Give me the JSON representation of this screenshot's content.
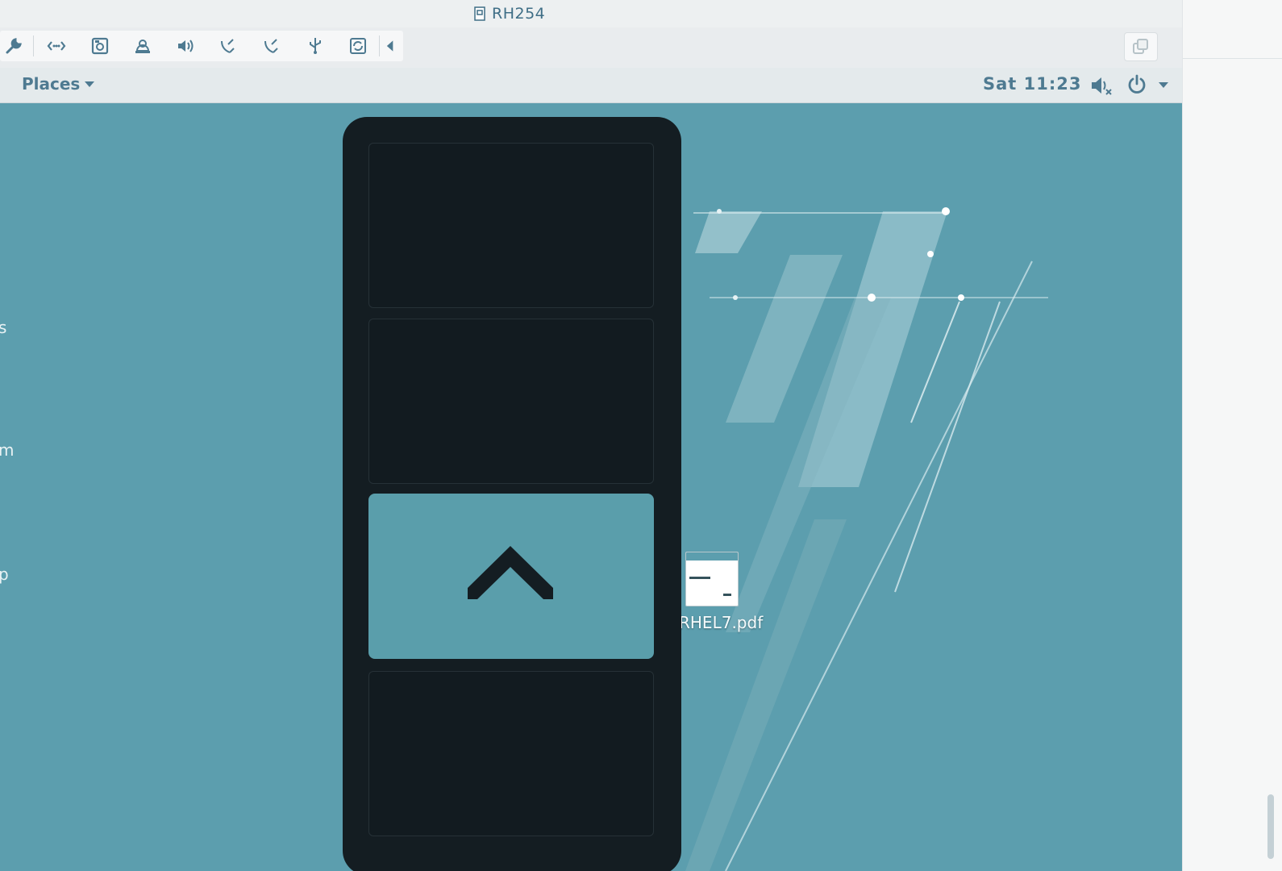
{
  "window": {
    "title": "RH254"
  },
  "toolbar": {
    "buttons": [
      {
        "name": "settings-wrench-icon"
      },
      {
        "name": "network-icon"
      },
      {
        "name": "disk-icon"
      },
      {
        "name": "shared-folder-icon"
      },
      {
        "name": "audio-icon"
      },
      {
        "name": "serial-port-icon"
      },
      {
        "name": "serial-port-icon-2"
      },
      {
        "name": "usb-icon"
      },
      {
        "name": "refresh-icon"
      },
      {
        "name": "collapse-left-icon"
      }
    ]
  },
  "panel": {
    "places_label": "Places",
    "clock": "Sat 11:23"
  },
  "desktop": {
    "left_fragments": [
      "s",
      "m",
      "p"
    ],
    "file": {
      "label": "RHEL7.pdf"
    }
  },
  "workspaces": {
    "count": 4,
    "active_index": 3
  },
  "colors": {
    "desktop_bg": "#5c9eae",
    "panel_text": "#4e7a91",
    "switcher_bg": "#141d22",
    "active_workspace": "#5a9eab"
  }
}
